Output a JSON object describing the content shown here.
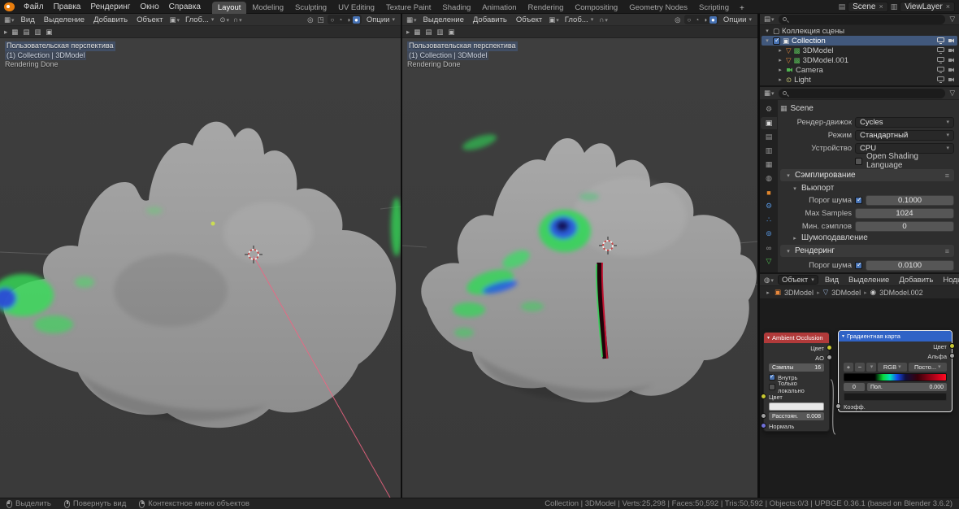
{
  "colors": {
    "accent": "#4772b3",
    "ao_node_header": "#b13a3a",
    "ramp_node_header": "#3063c6",
    "selected_row": "#41587c",
    "model_green": "#33dd55",
    "model_blue": "#2a52e8"
  },
  "topbar": {
    "menus": [
      "Файл",
      "Правка",
      "Рендеринг",
      "Окно",
      "Справка"
    ],
    "workspaces": [
      "Layout",
      "Modeling",
      "Sculpting",
      "UV Editing",
      "Texture Paint",
      "Shading",
      "Animation",
      "Rendering",
      "Compositing",
      "Geometry Nodes",
      "Scripting"
    ],
    "active_workspace": "Layout",
    "add_tab": "+",
    "scene_label": "Scene",
    "view_layer_label": "ViewLayer"
  },
  "viewports": [
    {
      "menus": [
        "Вид",
        "Выделение",
        "Добавить",
        "Объект"
      ],
      "orientation": "Глоб...",
      "options_label": "Опции",
      "overlay": [
        "Пользовательская перспектива",
        "(1) Collection | 3DModel",
        "Rendering Done"
      ]
    },
    {
      "menus": [
        "Выделение",
        "Добавить",
        "Объект"
      ],
      "orientation": "Глоб...",
      "options_label": "Опции",
      "overlay": [
        "Пользовательская перспектива",
        "(1) Collection | 3DModel",
        "Rendering Done"
      ]
    }
  ],
  "outliner": {
    "scene_collection": "Коллекция сцены",
    "collection": "Collection",
    "items": [
      "3DModel",
      "3DModel.001",
      "Camera",
      "Light"
    ]
  },
  "properties": {
    "context_label": "Scene",
    "engine_label": "Рендер-движок",
    "engine_value": "Cycles",
    "feature_label": "Режим",
    "feature_value": "Стандартный",
    "device_label": "Устройство",
    "device_value": "CPU",
    "osl_label": "Open Shading Language",
    "sampling_section": "Сэмплирование",
    "viewport_sub": "Вьюпорт",
    "noise_label": "Порог шума",
    "noise_value": "0.1000",
    "max_samples_label": "Max Samples",
    "max_samples_value": "1024",
    "min_samples_label": "Мин. сэмплов",
    "min_samples_value": "0",
    "denoise_section": "Шумоподавление",
    "render_section": "Рендеринг",
    "render_noise_label": "Порог шума",
    "render_noise_value": "0.0100"
  },
  "shader": {
    "type_label": "Объект",
    "menus": [
      "Вид",
      "Выделение",
      "Добавить",
      "Ноды"
    ],
    "breadcrumb": [
      "3DModel",
      "3DModel",
      "3DModel.002"
    ],
    "ao": {
      "title": "Ambient Occlusion",
      "out_color": "Цвет",
      "out_ao": "AO",
      "samples_label": "Сэмплы",
      "samples_value": "16",
      "inside_label": "Внутрь",
      "only_local_label": "Только локально",
      "color_label": "Цвет",
      "distance_label": "Расстоян.",
      "distance_value": "0.008",
      "normal_label": "Нормаль"
    },
    "ramp": {
      "title": "Градиентная карта",
      "out_color": "Цвет",
      "out_alpha": "Альфа",
      "add": "+",
      "remove": "−",
      "mode": "RGB",
      "interp": "Посто...",
      "index_value": "0",
      "pos_label": "Пол.",
      "pos_value": "0.000",
      "fac_label": "Коэфф."
    }
  },
  "statusbar": {
    "select": "Выделить",
    "rotate": "Повернуть вид",
    "context_menu": "Контекстное меню объектов",
    "stats": "Collection | 3DModel | Verts:25,298 | Faces:50,592 | Tris:50,592 | Objects:0/3 | UPBGE 0.36.1 (based on Blender 3.6.2)"
  }
}
